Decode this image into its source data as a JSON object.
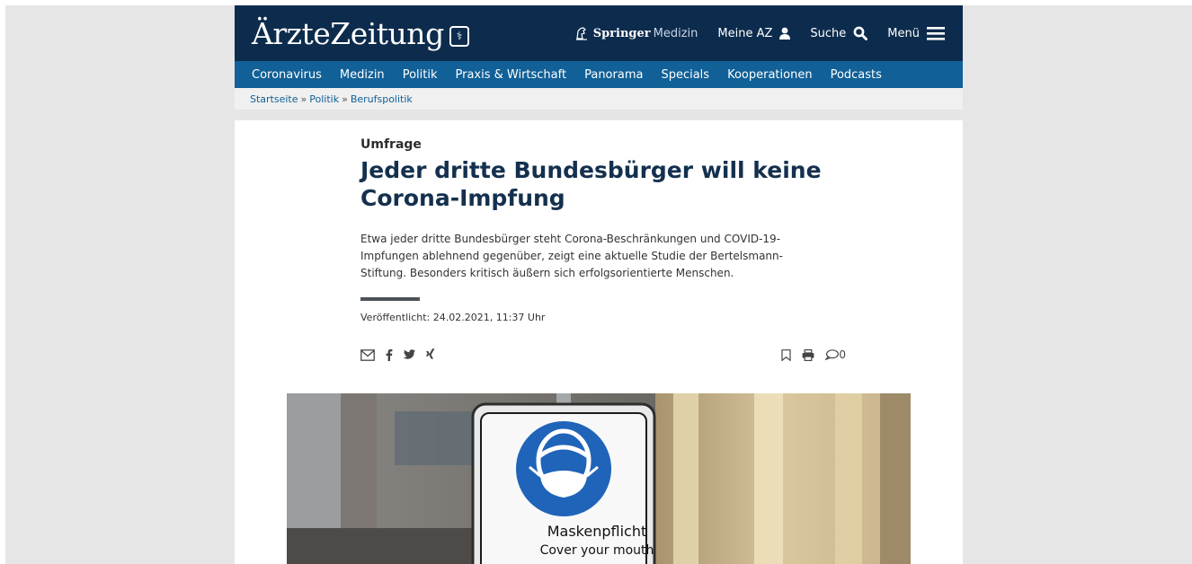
{
  "header": {
    "logo_text": "ÄrzteZeitung",
    "logo_badge_icon": "caduceus-icon",
    "springer_bold": "Springer",
    "springer_light": "Medizin",
    "meine_az_label": "Meine AZ",
    "suche_label": "Suche",
    "menu_label": "Menü",
    "colors": {
      "header_bg": "#0d2c4d",
      "nav_bg": "#116097"
    }
  },
  "nav": {
    "items": [
      "Coronavirus",
      "Medizin",
      "Politik",
      "Praxis & Wirtschaft",
      "Panorama",
      "Specials",
      "Kooperationen",
      "Podcasts"
    ]
  },
  "breadcrumb": {
    "items": [
      "Startseite",
      "Politik",
      "Berufspolitik"
    ],
    "separator": "»"
  },
  "article": {
    "kicker": "Umfrage",
    "headline": "Jeder dritte Bundesbürger will keine Corona-Impfung",
    "lead": "Etwa jeder dritte Bundesbürger steht Corona-Beschränkungen und COVID-19-Impfungen ablehnend gegenüber, zeigt eine aktuelle Studie der Bertelsmann-Stiftung. Besonders kritisch äußern sich erfolgsorientierte Menschen.",
    "published": "Veröffentlicht: 24.02.2021, 11:37 Uhr",
    "share_icons": [
      "mail-icon",
      "facebook-icon",
      "twitter-icon",
      "xing-icon"
    ],
    "comment_count": "0"
  },
  "hero": {
    "sign_line1": "Maskenpflicht",
    "sign_line2": "Cover your mouth"
  }
}
